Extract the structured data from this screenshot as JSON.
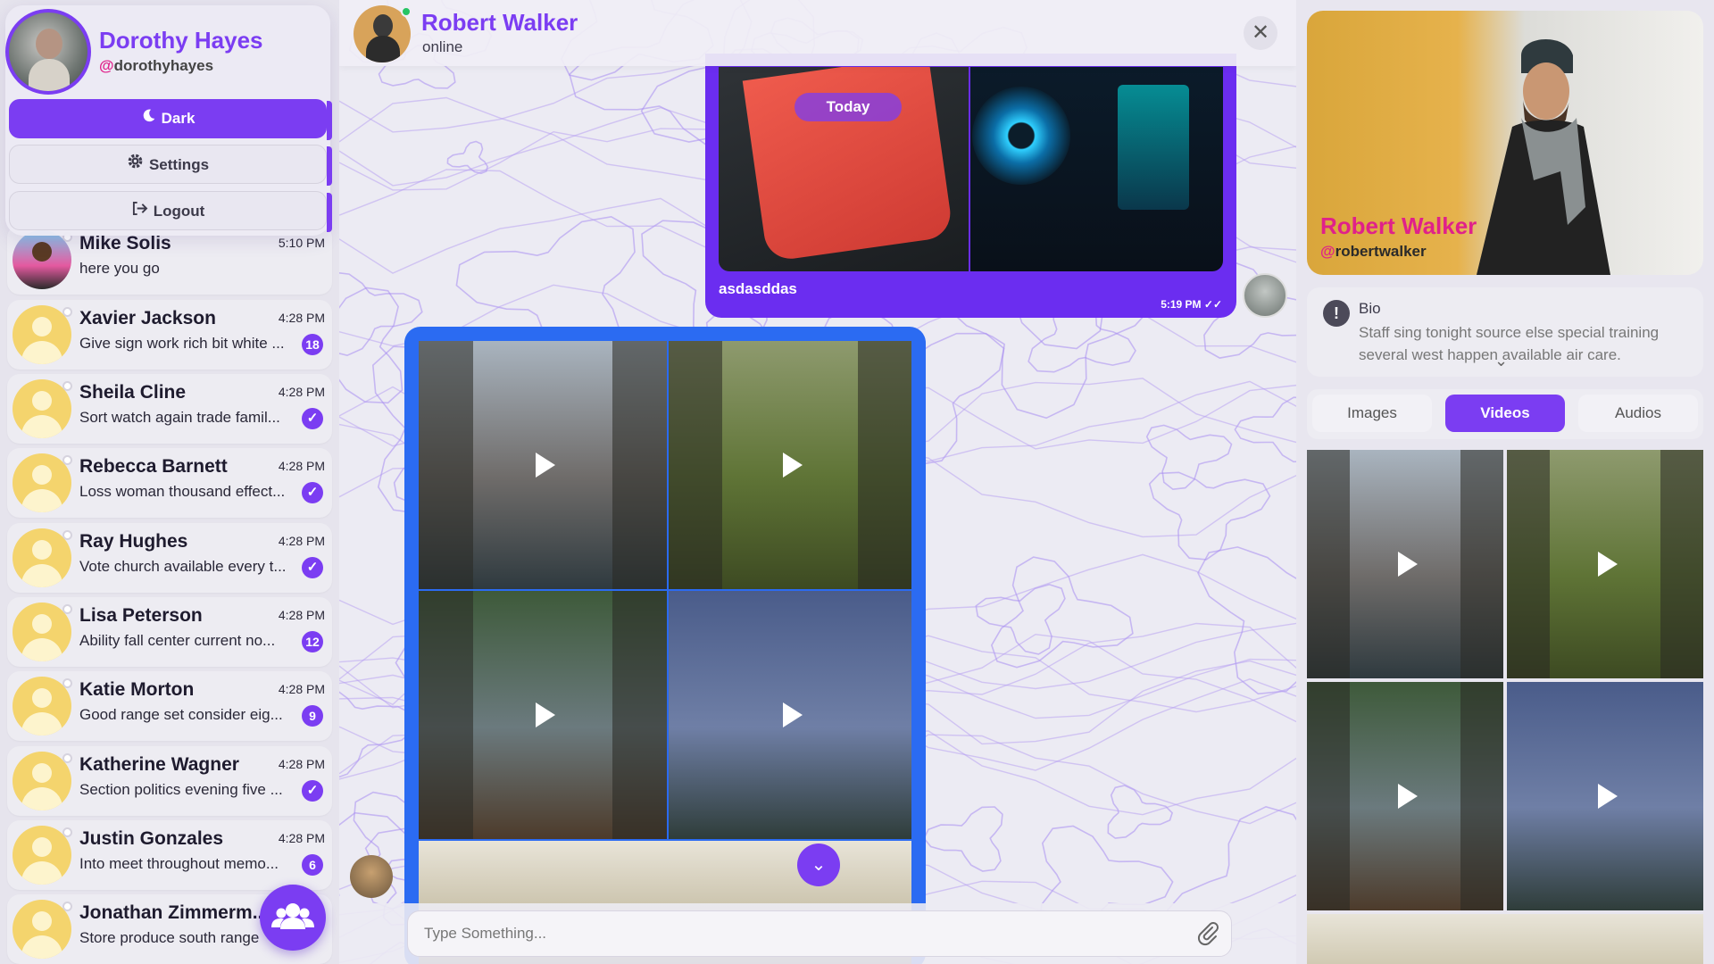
{
  "user": {
    "name": "Dorothy Hayes",
    "username_at": "@",
    "username": "dorothyhayes"
  },
  "menu": {
    "dark_label": "Dark",
    "settings_label": "Settings",
    "logout_label": "Logout"
  },
  "chats": [
    {
      "name": "Mike Solis",
      "time": "5:10 PM",
      "preview": "here you go",
      "badge": ""
    },
    {
      "name": "Xavier Jackson",
      "time": "4:28 PM",
      "preview": "Give sign work rich bit white ...",
      "badge": "18"
    },
    {
      "name": "Sheila Cline",
      "time": "4:28 PM",
      "preview": "Sort watch again trade famil...",
      "badge": "✓"
    },
    {
      "name": "Rebecca Barnett",
      "time": "4:28 PM",
      "preview": "Loss woman thousand effect...",
      "badge": "✓"
    },
    {
      "name": "Ray Hughes",
      "time": "4:28 PM",
      "preview": "Vote church available every t...",
      "badge": "✓"
    },
    {
      "name": "Lisa Peterson",
      "time": "4:28 PM",
      "preview": "Ability fall center current no...",
      "badge": "12"
    },
    {
      "name": "Katie Morton",
      "time": "4:28 PM",
      "preview": "Good range set consider eig...",
      "badge": "9"
    },
    {
      "name": "Katherine Wagner",
      "time": "4:28 PM",
      "preview": "Section politics evening five ...",
      "badge": "✓"
    },
    {
      "name": "Justin Gonzales",
      "time": "4:28 PM",
      "preview": "Into meet throughout memo...",
      "badge": "6"
    },
    {
      "name": "Jonathan Zimmerm...",
      "time": "",
      "preview": "Store produce south range",
      "badge": ""
    }
  ],
  "header": {
    "name": "Robert Walker",
    "status": "online",
    "close_glyph": "✕"
  },
  "messages": {
    "date_pill": "Today",
    "msg1_text": "asdasddas",
    "msg1_time": "5:19 PM"
  },
  "composer": {
    "placeholder": "Type Something..."
  },
  "profile": {
    "name": "Robert Walker",
    "username_at": "@",
    "username": "robertwalker"
  },
  "bio": {
    "title": "Bio",
    "text": "Staff sing tonight source else special training several west happen available air care."
  },
  "tabs": [
    "Images",
    "Videos",
    "Audios"
  ],
  "active_tab": "Videos",
  "colors": {
    "accent": "#7b3df2",
    "pink": "#e0218a",
    "blue_bubble": "#2b6bf2",
    "online": "#26c464"
  },
  "icons": {
    "theme": "moon-icon",
    "settings": "gear-icon",
    "logout": "logout-icon",
    "fab": "users-icon",
    "attach": "paperclip-icon",
    "scroll": "chevron-down-icon",
    "media": "play-icon"
  }
}
